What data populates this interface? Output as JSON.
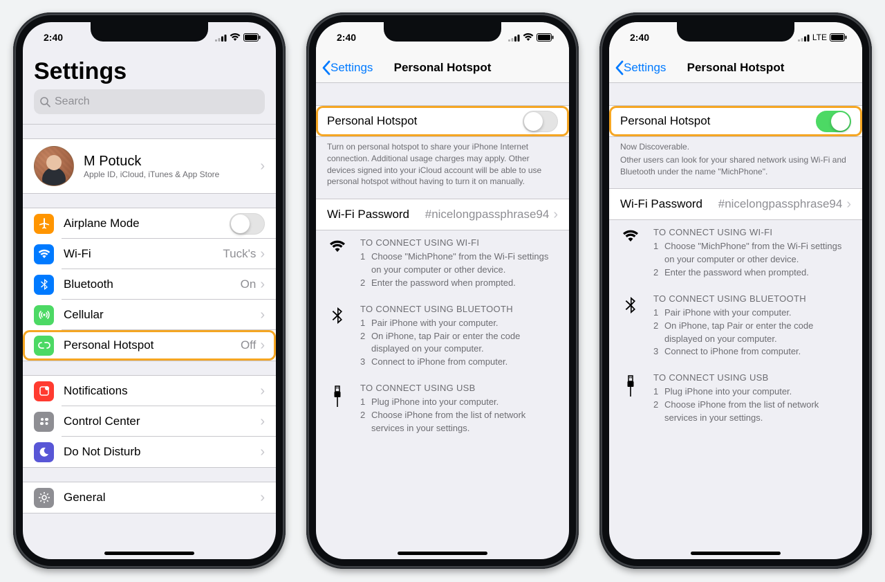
{
  "status": {
    "time": "2:40",
    "carrier_mode": "LTE"
  },
  "root": {
    "title": "Settings",
    "search_placeholder": "Search",
    "profile": {
      "name": "M Potuck",
      "subtitle": "Apple ID, iCloud, iTunes & App Store"
    },
    "rows": {
      "airplane": {
        "label": "Airplane Mode",
        "color": "#ff9500"
      },
      "wifi": {
        "label": "Wi-Fi",
        "value": "Tuck's",
        "color": "#007aff"
      },
      "bluetooth": {
        "label": "Bluetooth",
        "value": "On",
        "color": "#007aff"
      },
      "cellular": {
        "label": "Cellular",
        "color": "#4cd964"
      },
      "hotspot": {
        "label": "Personal Hotspot",
        "value": "Off",
        "color": "#4cd964"
      },
      "notifications": {
        "label": "Notifications",
        "color": "#ff3b30"
      },
      "controlcenter": {
        "label": "Control Center",
        "color": "#8e8e93"
      },
      "dnd": {
        "label": "Do Not Disturb",
        "color": "#5856d6"
      },
      "general": {
        "label": "General",
        "color": "#8e8e93"
      }
    }
  },
  "hotspot": {
    "nav_back": "Settings",
    "nav_title": "Personal Hotspot",
    "toggle_label": "Personal Hotspot",
    "off_footer": "Turn on personal hotspot to share your iPhone Internet connection. Additional usage charges may apply. Other devices signed into your iCloud account will be able to use personal hotspot without having to turn it on manually.",
    "on_footer_line1": "Now Discoverable.",
    "on_footer_line2": "Other users can look for your shared network using Wi-Fi and Bluetooth under the name \"MichPhone\".",
    "wifi_pw_label": "Wi-Fi Password",
    "wifi_pw_value": "#nicelongpassphrase94",
    "connect_wifi": {
      "title": "TO CONNECT USING WI-FI",
      "step1": "Choose \"MichPhone\" from the Wi-Fi settings on your computer or other device.",
      "step2": "Enter the password when prompted."
    },
    "connect_bt": {
      "title": "TO CONNECT USING BLUETOOTH",
      "step1": "Pair iPhone with your computer.",
      "step2": "On iPhone, tap Pair or enter the code displayed on your computer.",
      "step3": "Connect to iPhone from computer."
    },
    "connect_usb": {
      "title": "TO CONNECT USING USB",
      "step1": "Plug iPhone into your computer.",
      "step2": "Choose iPhone from the list of network services in your settings."
    }
  }
}
